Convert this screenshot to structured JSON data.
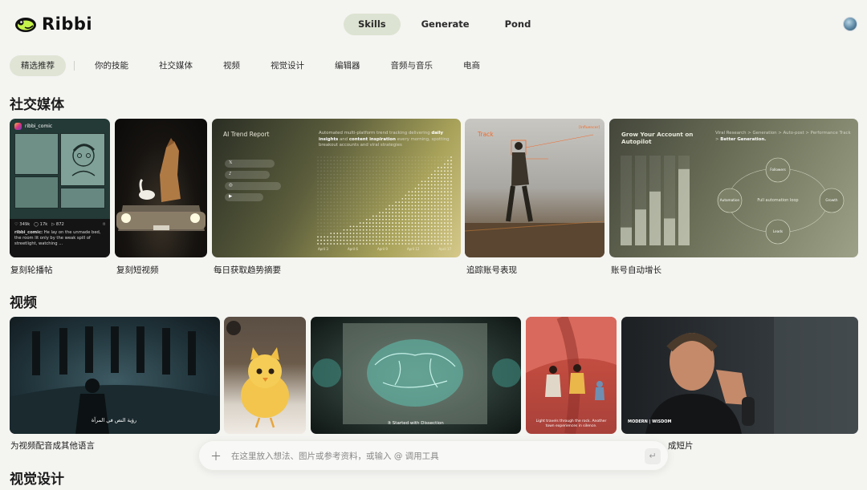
{
  "app": {
    "brand": "Ribbi"
  },
  "nav": {
    "tabs": [
      "Skills",
      "Generate",
      "Pond"
    ],
    "active": "Skills"
  },
  "categories": [
    "精选推荐",
    "你的技能",
    "社交媒体",
    "视频",
    "视觉设计",
    "编辑器",
    "音频与音乐",
    "电商"
  ],
  "sections": {
    "social": {
      "title": "社交媒体",
      "cards": [
        {
          "label": "复刻轮播帖"
        },
        {
          "label": "复刻短视频"
        },
        {
          "label": "每日获取趋势摘要"
        },
        {
          "label": "追踪账号表现"
        },
        {
          "label": "账号自动增长"
        }
      ]
    },
    "video": {
      "title": "视频",
      "cards": [
        {
          "label": "为视频配音成其他语言"
        },
        {
          "label": ""
        },
        {
          "label": ""
        },
        {
          "label": ""
        },
        {
          "label": "成短片"
        }
      ]
    },
    "visual": {
      "title": "视觉设计"
    }
  },
  "card_text": {
    "comic": {
      "account": "ribbi_comic",
      "stats": [
        "♡ 349k",
        "◯ 17k",
        "▷ 872",
        "⌑"
      ],
      "caption_user": "ribbi_comic:",
      "caption": "He lay on the unmade bed, the room lit only by the weak spill of streetlight, watching ..."
    },
    "trend": {
      "title": "AI Trend Report",
      "desc_plain_1": "Automated multi-platform trend tracking delivering ",
      "desc_bold_1": "daily insights",
      "desc_plain_2": " and ",
      "desc_bold_2": "content inspiration",
      "desc_plain_3": " every morning, spotting breakout accounts and viral strategies",
      "pills": [
        "𝕏",
        "♪",
        "◎",
        "▶"
      ],
      "x_ticks": [
        "April 3",
        "April 6",
        "April 9",
        "April 12",
        "April 17"
      ]
    },
    "track": {
      "label": "Track",
      "tag": "[Influencer]"
    },
    "growth": {
      "title": "Grow Your Account on Autopilot",
      "desc_plain": "Viral Research > Generation > Auto-post > Performance Track > ",
      "desc_bold": "Better Generation.",
      "nodes": [
        "Followers",
        "Growth",
        "Leads",
        "Automation"
      ],
      "center": "Full automation loop"
    },
    "mirror_caption": "رؤية النص في المرآة",
    "brain_caption": "It Started with Dissection",
    "desert_caption": "Light travels through the rock. Another town experiences in silence.",
    "podcast_brand": "MODERN | WISDOM"
  },
  "prompt": {
    "placeholder": "在这里放入想法、图片或参考资料，或输入 @ 调用工具"
  },
  "colors": {
    "accent_tab_bg": "#dde3d2",
    "page_bg": "#f4f4f1",
    "track_orange": "#f26a2b"
  }
}
